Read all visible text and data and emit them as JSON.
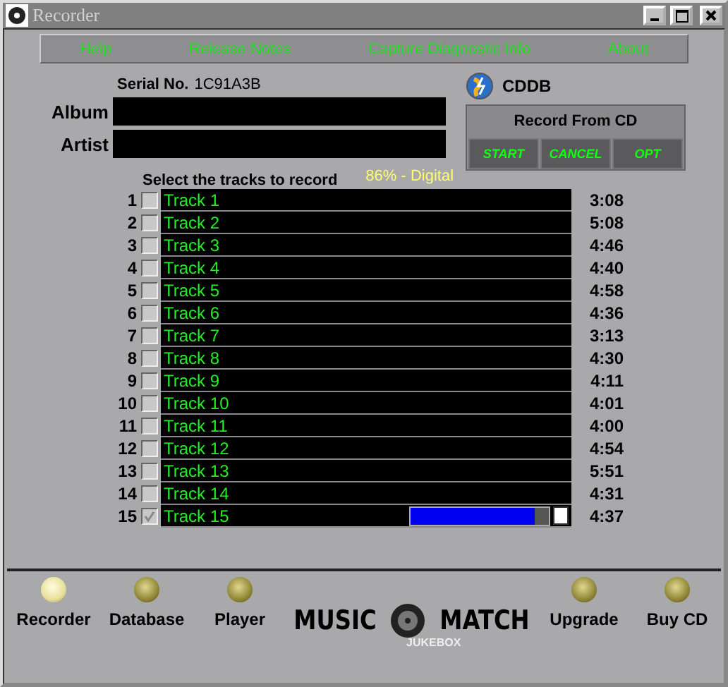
{
  "window": {
    "title": "Recorder"
  },
  "menu": [
    "Help",
    "Release Notes",
    "Capture Diagnostic Info",
    "About"
  ],
  "serial": {
    "label": "Serial No.",
    "value": "1C91A3B"
  },
  "fields": [
    {
      "label": "Album"
    },
    {
      "label": "Artist"
    }
  ],
  "cddb": {
    "label": "CDDB"
  },
  "record_panel": {
    "title": "Record From CD",
    "buttons": [
      "START",
      "CANCEL",
      "OPT"
    ]
  },
  "tracks_header": "Select the tracks to record",
  "status": "86% - Digital",
  "tracks": [
    {
      "number": "1",
      "title": "Track 1",
      "time": "3:08",
      "checked": false
    },
    {
      "number": "2",
      "title": "Track 2",
      "time": "5:08",
      "checked": false
    },
    {
      "number": "3",
      "title": "Track 3",
      "time": "4:46",
      "checked": false
    },
    {
      "number": "4",
      "title": "Track 4",
      "time": "4:40",
      "checked": false
    },
    {
      "number": "5",
      "title": "Track 5",
      "time": "4:58",
      "checked": false
    },
    {
      "number": "6",
      "title": "Track 6",
      "time": "4:36",
      "checked": false
    },
    {
      "number": "7",
      "title": "Track 7",
      "time": "3:13",
      "checked": false
    },
    {
      "number": "8",
      "title": "Track 8",
      "time": "4:30",
      "checked": false
    },
    {
      "number": "9",
      "title": "Track 9",
      "time": "4:11",
      "checked": false
    },
    {
      "number": "10",
      "title": "Track 10",
      "time": "4:01",
      "checked": false
    },
    {
      "number": "11",
      "title": "Track 11",
      "time": "4:00",
      "checked": false
    },
    {
      "number": "12",
      "title": "Track 12",
      "time": "4:54",
      "checked": false
    },
    {
      "number": "13",
      "title": "Track 13",
      "time": "5:51",
      "checked": false
    },
    {
      "number": "14",
      "title": "Track 14",
      "time": "4:31",
      "checked": false
    },
    {
      "number": "15",
      "title": "Track 15",
      "time": "4:37",
      "checked": true,
      "progress": {
        "level": 0.9
      }
    }
  ],
  "nav_left": [
    {
      "label": "Recorder",
      "selected": true
    },
    {
      "label": "Database",
      "selected": false
    },
    {
      "label": "Player",
      "selected": false
    }
  ],
  "logo": {
    "left": "MUSIC",
    "right": "MATCH",
    "sub": "JUKEBOX"
  },
  "nav_right": [
    {
      "label": "Upgrade",
      "selected": false
    },
    {
      "label": "Buy CD",
      "selected": false
    }
  ]
}
